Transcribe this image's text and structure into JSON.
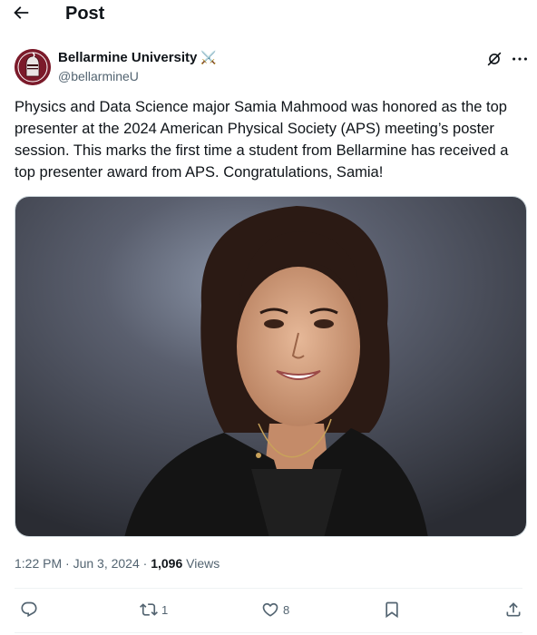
{
  "header": {
    "title": "Post",
    "back_icon": "arrow-left-icon"
  },
  "author": {
    "name": "Bellarmine University",
    "badge": "⚔️",
    "handle": "@bellarmineU",
    "avatar_color": "#7b1a2a"
  },
  "post": {
    "text": "Physics and Data Science major Samia Mahmood was honored as the top presenter at the 2024 American Physical Society (APS) meeting’s poster session. This marks the first time a student from Bellarmine has received a top presenter award from APS. Congratulations, Samia!",
    "time": "1:22 PM · Jun 3, 2024 · ",
    "views_count": "1,096",
    "views_label": " Views"
  },
  "actions": {
    "reply_count": "",
    "repost_count": "1",
    "like_count": "8",
    "bookmark_count": "",
    "share_count": ""
  },
  "colors": {
    "text": "#0f1419",
    "secondary": "#536471",
    "border": "#eff3f4"
  }
}
